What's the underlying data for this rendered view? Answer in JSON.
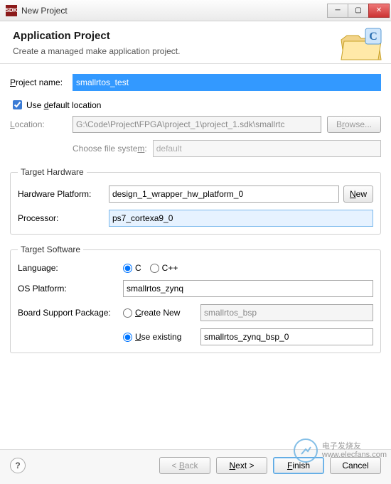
{
  "window": {
    "title": "New Project",
    "app_icon_text": "SDK"
  },
  "header": {
    "title": "Application Project",
    "subtitle": "Create a managed make application project."
  },
  "project": {
    "name_label": "Project name:",
    "name_value": "smallrtos_test",
    "use_default_label_pre": "Use ",
    "use_default_label_u": "d",
    "use_default_label_post": "efault location",
    "use_default_checked": true,
    "location_label_u": "L",
    "location_label_post": "ocation:",
    "location_value": "G:\\Code\\Project\\FPGA\\project_1\\project_1.sdk\\smallrtc",
    "browse_label": "Browse...",
    "filesys_label": "Choose file system:",
    "filesys_value": "default"
  },
  "target_hw": {
    "legend": "Target Hardware",
    "platform_label": "Hardware Platform:",
    "platform_value": "design_1_wrapper_hw_platform_0",
    "new_label": "New",
    "processor_label": "Processor:",
    "processor_value": "ps7_cortexa9_0"
  },
  "target_sw": {
    "legend": "Target Software",
    "language_label": "Language:",
    "lang_c": "C",
    "lang_cpp": "C++",
    "os_label": "OS Platform:",
    "os_value": "smallrtos_zynq",
    "bsp_label": "Board Support Package:",
    "bsp_create_u": "C",
    "bsp_create_post": "reate New",
    "bsp_create_value": "smallrtos_bsp",
    "bsp_use_u": "U",
    "bsp_use_post": "se existing",
    "bsp_use_value": "smallrtos_zynq_bsp_0"
  },
  "footer": {
    "back_pre": "< ",
    "back_u": "B",
    "back_post": "ack",
    "next_u": "N",
    "next_post": "ext >",
    "finish_u": "F",
    "finish_post": "inish",
    "cancel": "Cancel"
  },
  "watermark": {
    "line1": "电子发烧友",
    "line2": "www.elecfans.com"
  }
}
